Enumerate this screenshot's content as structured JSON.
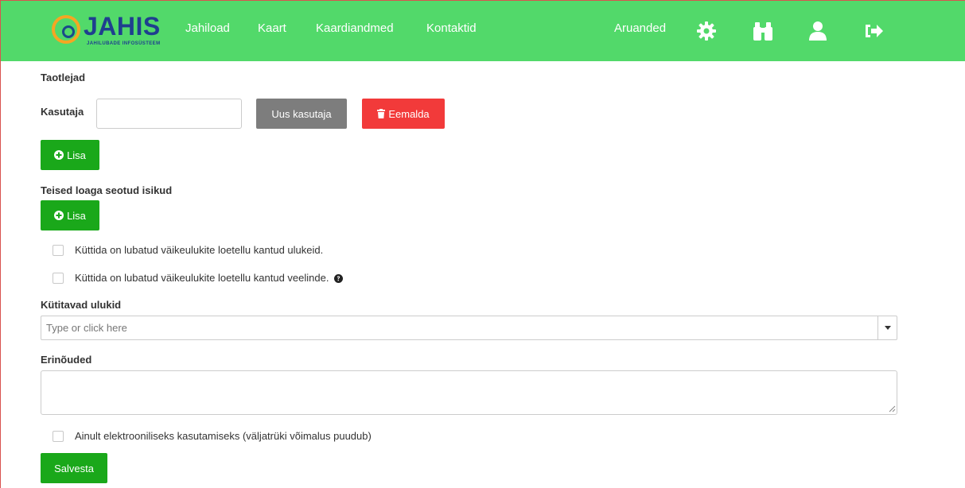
{
  "header": {
    "logo_text": "JAHIS",
    "logo_sub": "JAHILUBADE INFOSÜSTEEM",
    "nav": [
      "Jahiload",
      "Kaart",
      "Kaardiandmed",
      "Kontaktid"
    ],
    "right_link": "Aruanded",
    "icons": [
      "gear-icon",
      "binoculars-icon",
      "user-icon",
      "sign-out-icon"
    ],
    "colors": {
      "navbar": "#52d96a",
      "logo": "#1f3f8f",
      "logo_ring": "#f5a623"
    }
  },
  "form": {
    "applicants_title": "Taotlejad",
    "user_label": "Kasutaja",
    "user_value": "",
    "new_user_button": "Uus kasutaja",
    "remove_button": "Eemalda",
    "add_button": "Lisa",
    "others_title": "Teised loaga seotud isikud",
    "add_button_2": "Lisa",
    "checkboxes": [
      {
        "label": "Küttida on lubatud väikeulukite loetellu kantud ulukeid.",
        "checked": false
      },
      {
        "label": "Küttida on lubatud väikeulukite loetellu kantud veelinde.",
        "checked": false
      }
    ],
    "game_title": "Kütitavad ulukid",
    "game_placeholder": "Type or click here",
    "requirements_title": "Erinõuded",
    "requirements_value": "",
    "electronic_only": {
      "label": "Ainult elektrooniliseks kasutamiseks (väljatrüki võimalus puudub)",
      "checked": false
    },
    "save_button": "Salvesta",
    "colors": {
      "primary": "#1aa81a",
      "danger": "#f23a3a",
      "secondary": "#7d7d7d"
    }
  }
}
